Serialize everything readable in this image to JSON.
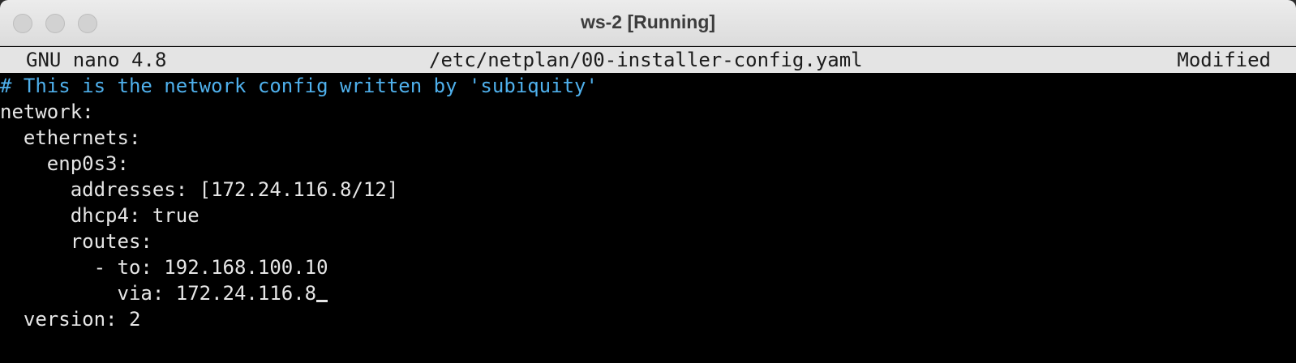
{
  "window": {
    "title": "ws-2 [Running]"
  },
  "nano_header": {
    "version": "GNU nano 4.8",
    "filename": "/etc/netplan/00-installer-config.yaml",
    "status": "Modified"
  },
  "editor": {
    "lines": [
      "# This is the network config written by 'subiquity'",
      "network:",
      "  ethernets:",
      "    enp0s3:",
      "      addresses: [172.24.116.8/12]",
      "      dhcp4: true",
      "      routes:",
      "        - to: 192.168.100.10",
      "          via: 172.24.116.8",
      "  version: 2"
    ]
  },
  "colors": {
    "comment": "#4fb0ec",
    "text": "#e6e6e6",
    "background": "#000000",
    "header_bg": "#e4e4e4"
  },
  "icons": [
    "close-button",
    "minimize-button",
    "zoom-button"
  ]
}
